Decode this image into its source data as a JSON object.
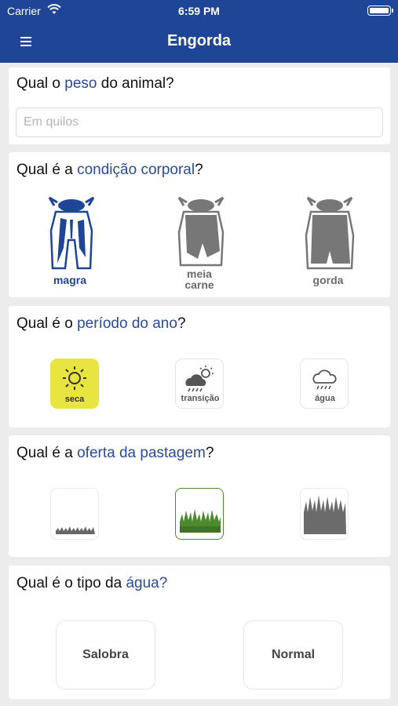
{
  "status_bar": {
    "carrier": "Carrier",
    "time": "6:59 PM"
  },
  "nav": {
    "title": "Engorda",
    "menu_icon": "hamburger-menu-icon"
  },
  "peso": {
    "question_pre": "Qual o ",
    "question_hl": "peso",
    "question_post": " do animal?",
    "placeholder": "Em quilos",
    "value": ""
  },
  "condicao": {
    "question_pre": "Qual é a ",
    "question_hl": "condição corporal",
    "question_post": "?",
    "options": [
      {
        "line1": "magra",
        "line2": "",
        "selected": true,
        "color": "#1f4596"
      },
      {
        "line1": "meia",
        "line2": "carne",
        "selected": false,
        "color": "#777777"
      },
      {
        "line1": "gorda",
        "line2": "",
        "selected": false,
        "color": "#777777"
      }
    ]
  },
  "periodo": {
    "question_pre": "Qual é o ",
    "question_hl": "período do ano",
    "question_post": "?",
    "options": [
      {
        "label": "seca",
        "icon": "sun-icon",
        "selected": true,
        "color": "#e8e542"
      },
      {
        "label": "transição",
        "icon": "sun-cloud-rain-icon",
        "selected": false
      },
      {
        "label": "água",
        "icon": "rain-cloud-icon",
        "selected": false
      }
    ]
  },
  "pastagem": {
    "question_pre": "Qual é a ",
    "question_hl": "oferta da pastagem",
    "question_post": "?",
    "options": [
      {
        "level": "low",
        "icon": "short-grass-icon",
        "selected": false
      },
      {
        "level": "medium",
        "icon": "green-grass-icon",
        "selected": true,
        "color": "#4d8a2e"
      },
      {
        "level": "high",
        "icon": "tall-grass-icon",
        "selected": false
      }
    ]
  },
  "agua": {
    "question_pre": "Qual é o tipo da ",
    "question_hl": "água?",
    "question_post": "",
    "options": [
      {
        "label": "Salobra"
      },
      {
        "label": "Normal"
      }
    ]
  },
  "colors": {
    "brand_blue": "#1f4596",
    "highlight_text": "#2a4a9c",
    "background": "#ececec"
  }
}
